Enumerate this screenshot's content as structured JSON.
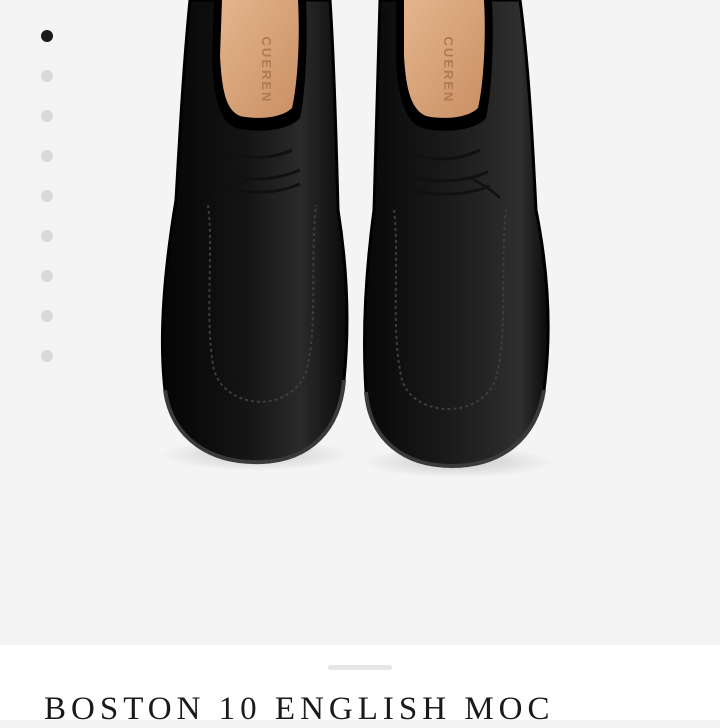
{
  "gallery": {
    "image_count": 9,
    "active_index": 0,
    "image_alt": "Black leather English moc shoes, top view",
    "insole_brand": "CUEREN"
  },
  "product": {
    "title": "BOSTON 10 ENGLISH MOC"
  },
  "colors": {
    "background": "#f4f4f4",
    "sheet": "#ffffff",
    "dot_active": "#1a1a1a",
    "dot_inactive": "#d9d9d9",
    "leather": "#0b0b0b",
    "insole": "#d9a77e"
  }
}
